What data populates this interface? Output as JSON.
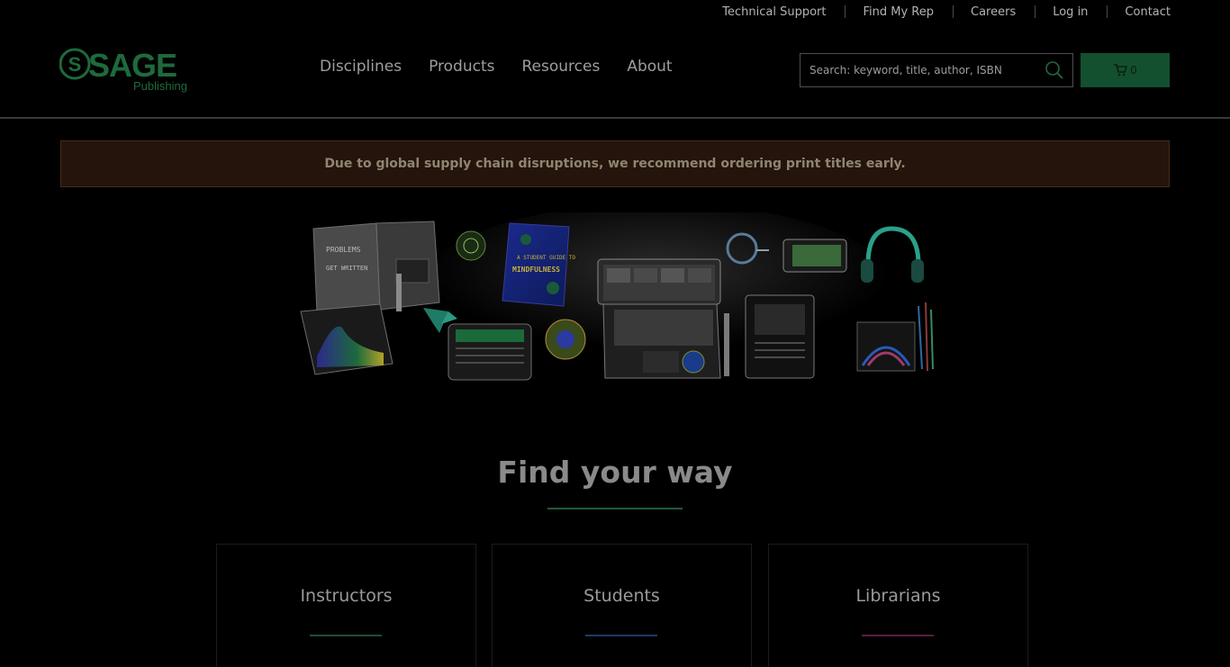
{
  "utility_links": [
    {
      "label": "Technical Support"
    },
    {
      "label": "Find My Rep"
    },
    {
      "label": "Careers"
    },
    {
      "label": "Log in"
    },
    {
      "label": "Contact"
    }
  ],
  "logo": {
    "brand": "SAGE",
    "tagline": "Publishing"
  },
  "main_nav": [
    {
      "label": "Disciplines"
    },
    {
      "label": "Products"
    },
    {
      "label": "Resources"
    },
    {
      "label": "About"
    }
  ],
  "search": {
    "placeholder": "Search: keyword, title, author, ISBN",
    "value": ""
  },
  "cart": {
    "count": "0"
  },
  "notice": {
    "text": "Due to global supply chain disruptions, we recommend ordering print titles early."
  },
  "hero": {
    "book_left_title": "PROBLEMS",
    "book_left_subtitle": "GET WRITTEN",
    "book_center_title": "MINDFULNESS",
    "book_center_top": "A STUDENT GUIDE TO"
  },
  "find": {
    "title": "Find your way"
  },
  "cards": [
    {
      "label": "Instructors",
      "accent": "#1d4f35"
    },
    {
      "label": "Students",
      "accent": "#1e3a6e"
    },
    {
      "label": "Librarians",
      "accent": "#5a1d3e"
    }
  ],
  "colors": {
    "brand_green": "#12502f",
    "notice_bg": "#24140b",
    "background": "#000000"
  }
}
